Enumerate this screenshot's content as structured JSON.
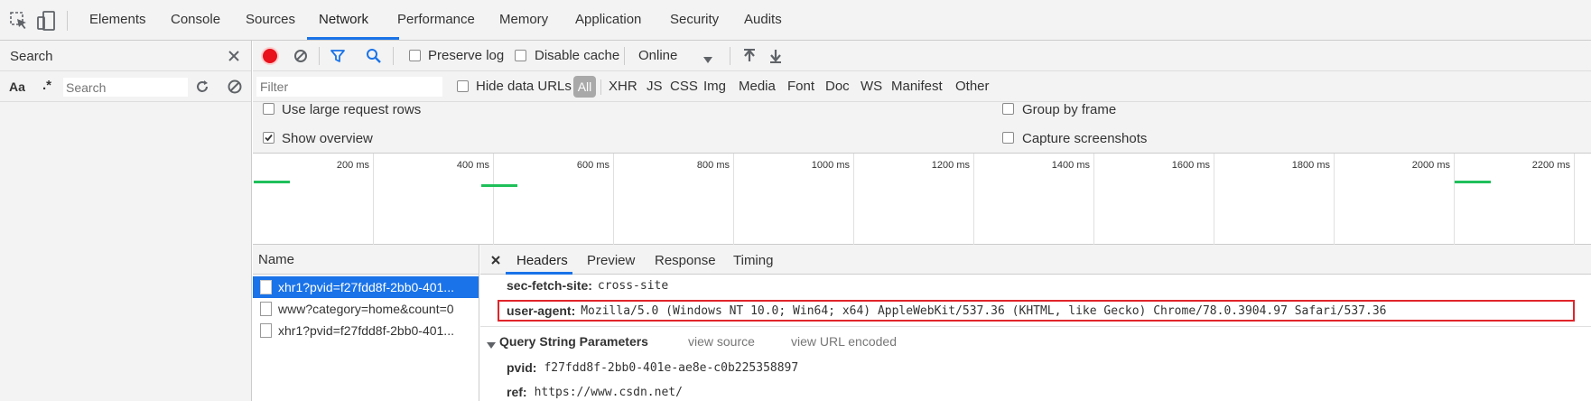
{
  "devtools": {
    "tabs": [
      "Elements",
      "Console",
      "Sources",
      "Network",
      "Performance",
      "Memory",
      "Application",
      "Security",
      "Audits"
    ],
    "active_tab": "Network"
  },
  "search_panel": {
    "title": "Search",
    "case_label": "Aa",
    "regex_label": ".*",
    "placeholder": "Search"
  },
  "toolbar": {
    "preserve_log": "Preserve log",
    "disable_cache": "Disable cache",
    "throttle": "Online"
  },
  "filter_bar": {
    "placeholder": "Filter",
    "hide_data_urls": "Hide data URLs",
    "types": [
      "All",
      "XHR",
      "JS",
      "CSS",
      "Img",
      "Media",
      "Font",
      "Doc",
      "WS",
      "Manifest",
      "Other"
    ]
  },
  "settings": {
    "large_rows": "Use large request rows",
    "show_overview": "Show overview",
    "group_by_frame": "Group by frame",
    "capture_screenshots": "Capture screenshots"
  },
  "overview": {
    "ticks": [
      "200 ms",
      "400 ms",
      "600 ms",
      "800 ms",
      "1000 ms",
      "1200 ms",
      "1400 ms",
      "1600 ms",
      "1800 ms",
      "2000 ms",
      "2200 ms"
    ]
  },
  "requests": {
    "header": "Name",
    "items": [
      "xhr1?pvid=f27fdd8f-2bb0-401...",
      "www?category=home&count=0",
      "xhr1?pvid=f27fdd8f-2bb0-401..."
    ]
  },
  "details": {
    "tabs": [
      "Headers",
      "Preview",
      "Response",
      "Timing"
    ],
    "active_tab": "Headers",
    "headers": [
      {
        "name": "sec-fetch-site:",
        "value": "cross-site"
      },
      {
        "name": "user-agent:",
        "value": "Mozilla/5.0 (Windows NT 10.0; Win64; x64) AppleWebKit/537.36 (KHTML, like Gecko) Chrome/78.0.3904.97 Safari/537.36"
      }
    ],
    "query_section": {
      "title": "Query String Parameters",
      "view_source": "view source",
      "view_url_encoded": "view URL encoded",
      "params": [
        {
          "name": "pvid:",
          "value": "f27fdd8f-2bb0-401e-ae8e-c0b225358897"
        },
        {
          "name": "ref:",
          "value": "https://www.csdn.net/"
        }
      ]
    }
  },
  "colors": {
    "accent": "#1a73e8",
    "record": "#e8111c",
    "selected_row": "#1a73e8",
    "highlight_box": "#e0252b",
    "overview_bar": "#1fbf5a"
  }
}
